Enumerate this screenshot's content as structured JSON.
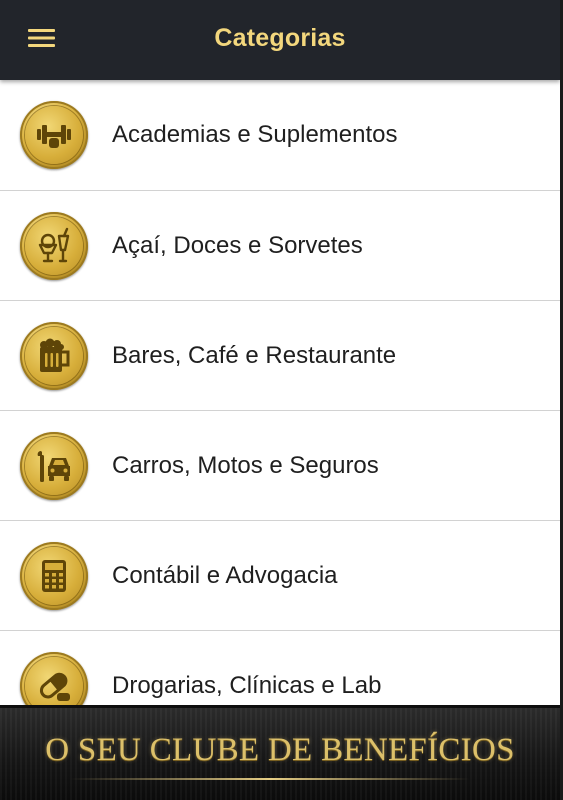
{
  "header": {
    "title": "Categorias",
    "menu_icon": "menu-icon",
    "title_color": "#f3d77d",
    "background": "#22252b"
  },
  "categories": [
    {
      "label": "Academias e Suplementos",
      "icon": "dumbbell-icon"
    },
    {
      "label": "Açaí, Doces e Sorvetes",
      "icon": "ice-cream-drink-icon"
    },
    {
      "label": "Bares, Café e Restaurante",
      "icon": "beer-mug-icon"
    },
    {
      "label": "Carros, Motos e Seguros",
      "icon": "car-wrench-icon"
    },
    {
      "label": "Contábil e Advogacia",
      "icon": "calculator-icon"
    },
    {
      "label": "Drogarias, Clínicas e Lab",
      "icon": "pill-icon"
    }
  ],
  "banner": {
    "text": "O SEU CLUBE DE BENEFÍCIOS",
    "text_color": "#dcc06a"
  },
  "accent_gold": "#d7ae3a"
}
